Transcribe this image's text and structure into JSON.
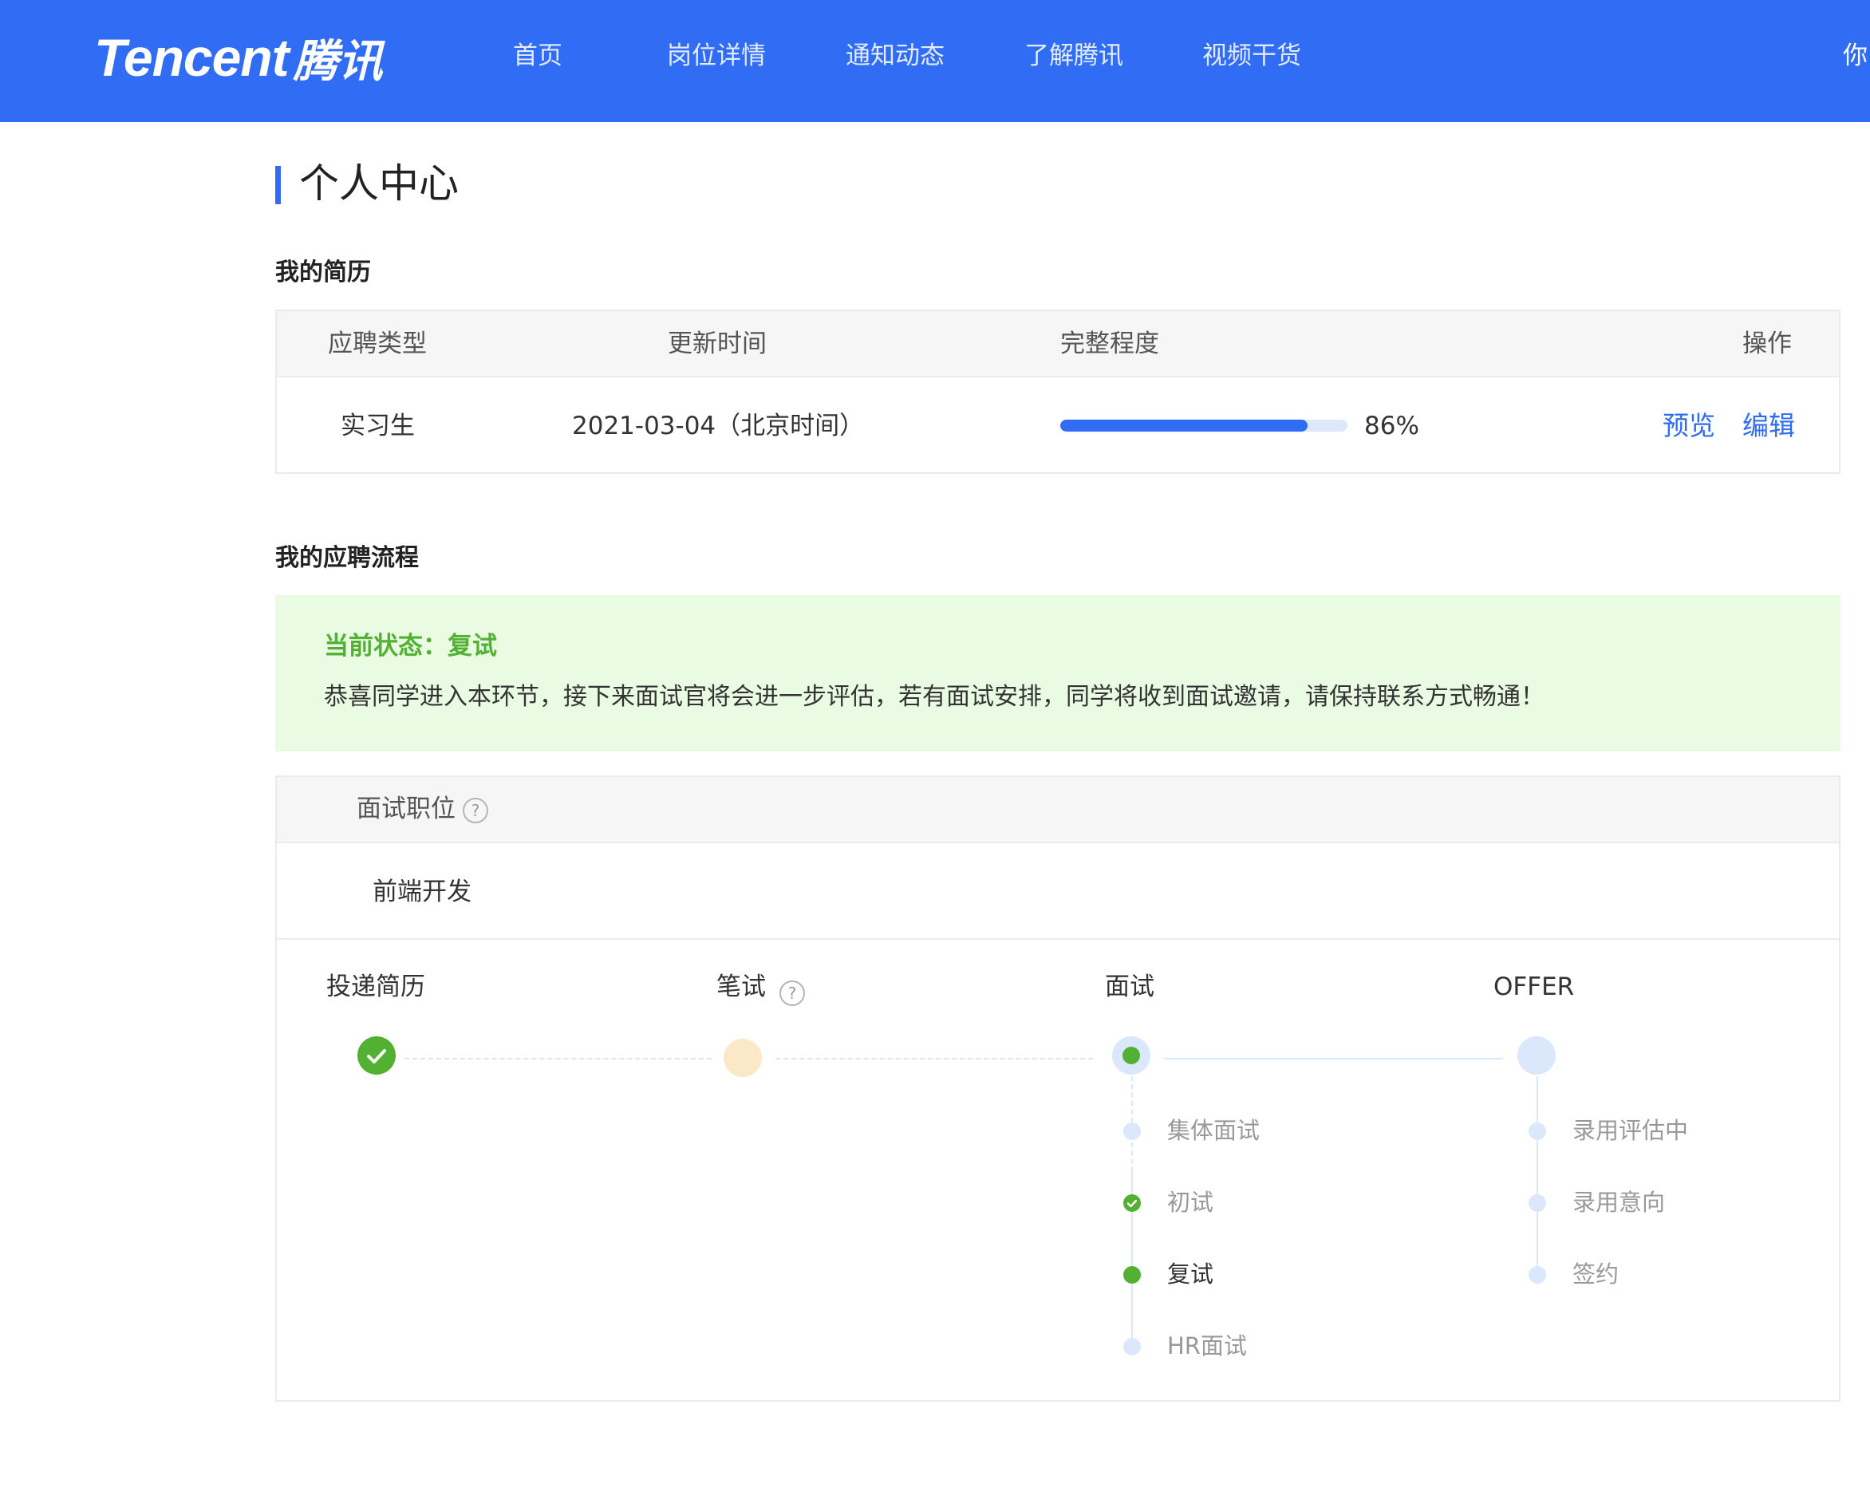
{
  "header": {
    "logo_en": "Tencent",
    "logo_cn": "腾讯",
    "nav": [
      "首页",
      "岗位详情",
      "通知动态",
      "了解腾讯",
      "视频干货"
    ],
    "user_partial": "你"
  },
  "page_title": "个人中心",
  "resume": {
    "section_title": "我的简历",
    "columns": [
      "应聘类型",
      "更新时间",
      "完整程度",
      "操作"
    ],
    "row": {
      "type": "实习生",
      "updated": "2021-03-04（北京时间）",
      "completeness": 86,
      "completeness_label": "86%",
      "actions": [
        "预览",
        "编辑"
      ]
    }
  },
  "process": {
    "section_title": "我的应聘流程",
    "status_title": "当前状态：复试",
    "status_message": "恭喜同学进入本环节，接下来面试官将会进一步评估，若有面试安排，同学将收到面试邀请，请保持联系方式畅通！",
    "position_header": "面试职位",
    "position_value": "前端开发",
    "help_icon_glyph": "?",
    "steps": [
      {
        "label": "投递简历",
        "state": "done"
      },
      {
        "label": "笔试",
        "state": "pending",
        "has_help": true
      },
      {
        "label": "面试",
        "state": "current"
      },
      {
        "label": "OFFER",
        "state": "future"
      }
    ],
    "interview_substeps": [
      {
        "label": "集体面试",
        "state": "future"
      },
      {
        "label": "初试",
        "state": "done"
      },
      {
        "label": "复试",
        "state": "current"
      },
      {
        "label": "HR面试",
        "state": "future"
      }
    ],
    "offer_substeps": [
      {
        "label": "录用评估中",
        "state": "future"
      },
      {
        "label": "录用意向",
        "state": "future"
      },
      {
        "label": "签约",
        "state": "future"
      }
    ]
  },
  "colors": {
    "brand_blue": "#316cf4",
    "success_green": "#52b132",
    "pending_orange": "#fbe8c7",
    "future_blue": "#dbe7fb"
  }
}
